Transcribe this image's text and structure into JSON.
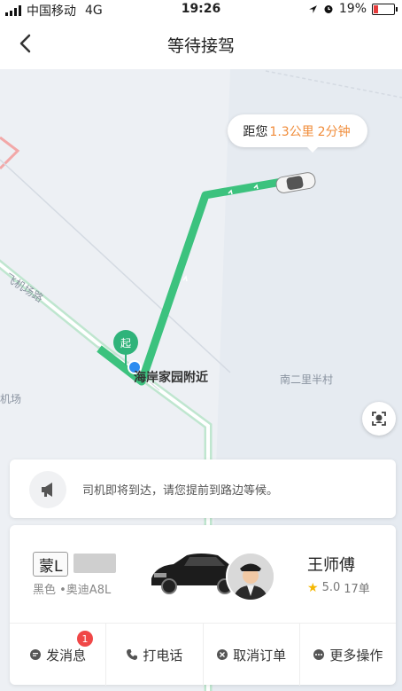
{
  "status_bar": {
    "carrier": "中国移动",
    "network": "4G",
    "time": "19:26",
    "battery": "19%",
    "battery_level": 0.19
  },
  "nav": {
    "title": "等待接驾"
  },
  "map": {
    "eta_prefix": "距您",
    "eta_distance": "1.3公里",
    "eta_time": "2分钟",
    "start_marker": "起",
    "pickup_place": "海岸家园附近",
    "labels": {
      "road": "飞机场路",
      "village": "南二里半村",
      "airport": "机场"
    },
    "route_color": "#3cc27e"
  },
  "notice": {
    "text": "司机即将到达，请您提前到路边等候。"
  },
  "driver": {
    "plate": "蒙L",
    "car_info": "黑色 •奥迪A8L",
    "name": "王师傅",
    "rating": "5.0",
    "orders": "17单"
  },
  "actions": [
    {
      "label": "发消息",
      "icon": "message-icon",
      "badge": "1"
    },
    {
      "label": "打电话",
      "icon": "phone-icon"
    },
    {
      "label": "取消订单",
      "icon": "cancel-icon"
    },
    {
      "label": "更多操作",
      "icon": "more-icon"
    }
  ]
}
